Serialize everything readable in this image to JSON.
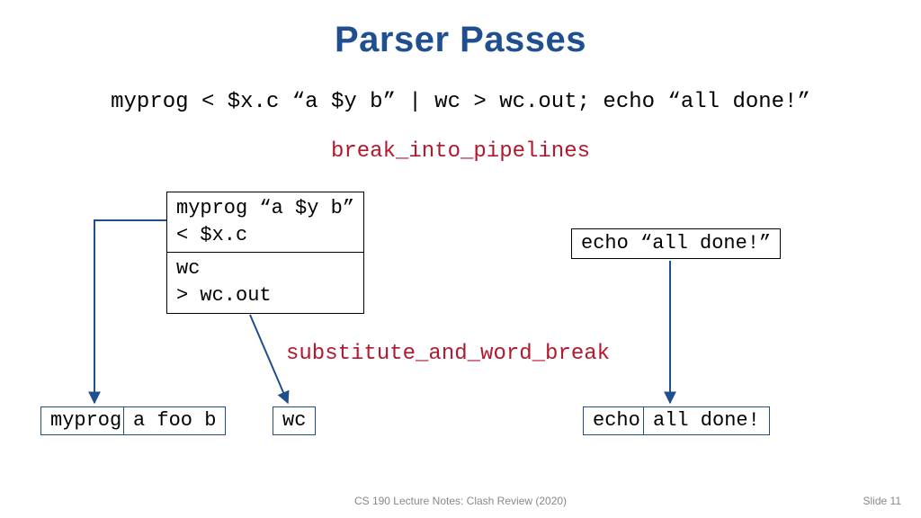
{
  "title": "Parser Passes",
  "command_line": "myprog < $x.c “a $y b” | wc > wc.out; echo “all done!”",
  "phases": {
    "break_into_pipelines": "break_into_pipelines",
    "substitute_and_word_break": "substitute_and_word_break"
  },
  "pipeline_box": {
    "row0_line0": "myprog “a $y b”",
    "row0_line1": "< $x.c",
    "row1_line0": "wc",
    "row1_line1": "> wc.out"
  },
  "echo_box": "echo “all done!”",
  "tokens": {
    "t0": "myprog",
    "t1": "a foo b",
    "t2": "wc",
    "t3": "echo",
    "t4": "all done!"
  },
  "footer": {
    "center": "CS 190 Lecture Notes: Clash Review (2020)",
    "right": "Slide 11"
  },
  "colors": {
    "title_blue": "#1f4f8f",
    "phase_red": "#b3192e",
    "token_border": "#1f4f8f"
  }
}
